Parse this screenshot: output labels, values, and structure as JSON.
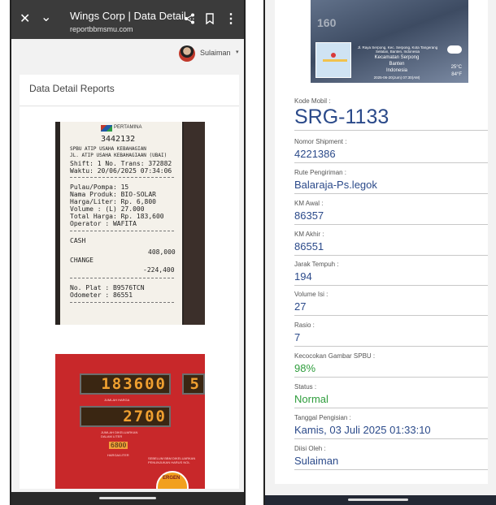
{
  "left": {
    "appbar": {
      "title": "Wings Corp | Data Detail...",
      "url": "reportbbmsmu.com",
      "icons": [
        "close-icon",
        "chevron-down-icon",
        "share-icon",
        "bookmark-icon",
        "more-vert-icon"
      ]
    },
    "user": {
      "name": "Sulaiman",
      "caret": "▾"
    },
    "page_header": "Data Detail Reports",
    "receipt": {
      "brand": "PERTAMINA",
      "number": "3442132",
      "lines": [
        "SPBU ATIP USAHA KEBAHAGIAN",
        "JL. ATIP USAHA KEBAHAGIAAN (UBAI)",
        "Shift: 1    No. Trans: 372882",
        "Waktu: 20/06/2025 07:34:06",
        "Pulau/Pompa: 15",
        "Nama Produk: BIO-SOLAR",
        "Harga/Liter: Rp. 6,800",
        "Volume    : (L) 27.000",
        "Total Harga: Rp. 183,600",
        "Operator  : WAFITA",
        "CASH",
        "408,000",
        "CHANGE",
        "-224,400",
        "No. Plat  : B9576TCN",
        "Odometer  : 86551"
      ]
    },
    "pump": {
      "amount": "183600",
      "amount_label": "JUMLAH HARGA",
      "liters": "2700",
      "liters_label": "JUMLAH DIKELUARKAN DALAM LITER",
      "price": "6800",
      "price_label": "HARGA/LITER",
      "side_digit": "5",
      "notice": "SEBELUM BBM DIKELUARKAN PENUNJUKAN HARUS NOL",
      "badge": "ERGEN"
    }
  },
  "right": {
    "photo": {
      "big_digits": "160",
      "location_lines": [
        "Kecamatan Serpong",
        "Banten",
        "Indonesia",
        "2025-06-20(Jum)  07:30(AM)"
      ],
      "address_line": "Jl. Raya Serpong, Kec. Serpong, Kota Tangerang Selatan, Banten, Indonesia",
      "temp_c": "25°C",
      "temp_f": "84°F"
    },
    "fields": [
      {
        "label": "Kode Mobil :",
        "value": "SRG-1133"
      },
      {
        "label": "Nomor Shipment :",
        "value": "4221386"
      },
      {
        "label": "Rute Pengiriman :",
        "value": "Balaraja-Ps.legok"
      },
      {
        "label": "KM Awal :",
        "value": "86357"
      },
      {
        "label": "KM Akhir :",
        "value": "86551"
      },
      {
        "label": "Jarak Tempuh :",
        "value": "194"
      },
      {
        "label": "Volume Isi :",
        "value": "27"
      },
      {
        "label": "Rasio :",
        "value": "7"
      },
      {
        "label": "Kecocokan Gambar SPBU :",
        "value": "98%"
      },
      {
        "label": "Status :",
        "value": "Normal"
      },
      {
        "label": "Tanggal Pengisian :",
        "value": "Kamis, 03 Juli 2025 01:33:10"
      },
      {
        "label": "Diisi Oleh :",
        "value": "Sulaiman"
      }
    ]
  },
  "colors": {
    "value_blue": "#2b4a8a",
    "ok_green": "#2e9d3c",
    "appbar": "#3b3b3b"
  }
}
